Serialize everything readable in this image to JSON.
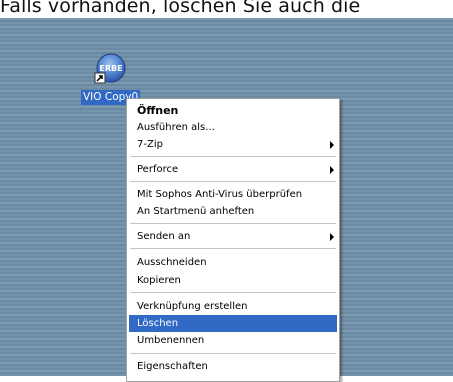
{
  "caption": "Falls vorhanden, löschen Sie auch die",
  "desktop": {
    "shortcut": {
      "icon_text": "ERBE",
      "label": "VIO Copy0"
    }
  },
  "context_menu": {
    "items": [
      {
        "label": "Öffnen",
        "bold": true
      },
      {
        "label": "Ausführen als..."
      },
      {
        "label": "7-Zip",
        "submenu": true
      },
      {
        "label": "Perforce",
        "submenu": true
      },
      {
        "label": "Mit Sophos Anti-Virus überprüfen"
      },
      {
        "label": "An Startmenü anheften"
      },
      {
        "label": "Senden an",
        "submenu": true
      },
      {
        "label": "Ausschneiden"
      },
      {
        "label": "Kopieren"
      },
      {
        "label": "Verknüpfung erstellen"
      },
      {
        "label": "Löschen",
        "highlighted": true
      },
      {
        "label": "Umbenennen"
      },
      {
        "label": "Eigenschaften"
      }
    ]
  },
  "colors": {
    "highlight": "#316ac5",
    "desktop": "#6f8fa7"
  },
  "icons": [
    "shortcut-arrow-icon",
    "submenu-arrow-icon"
  ]
}
